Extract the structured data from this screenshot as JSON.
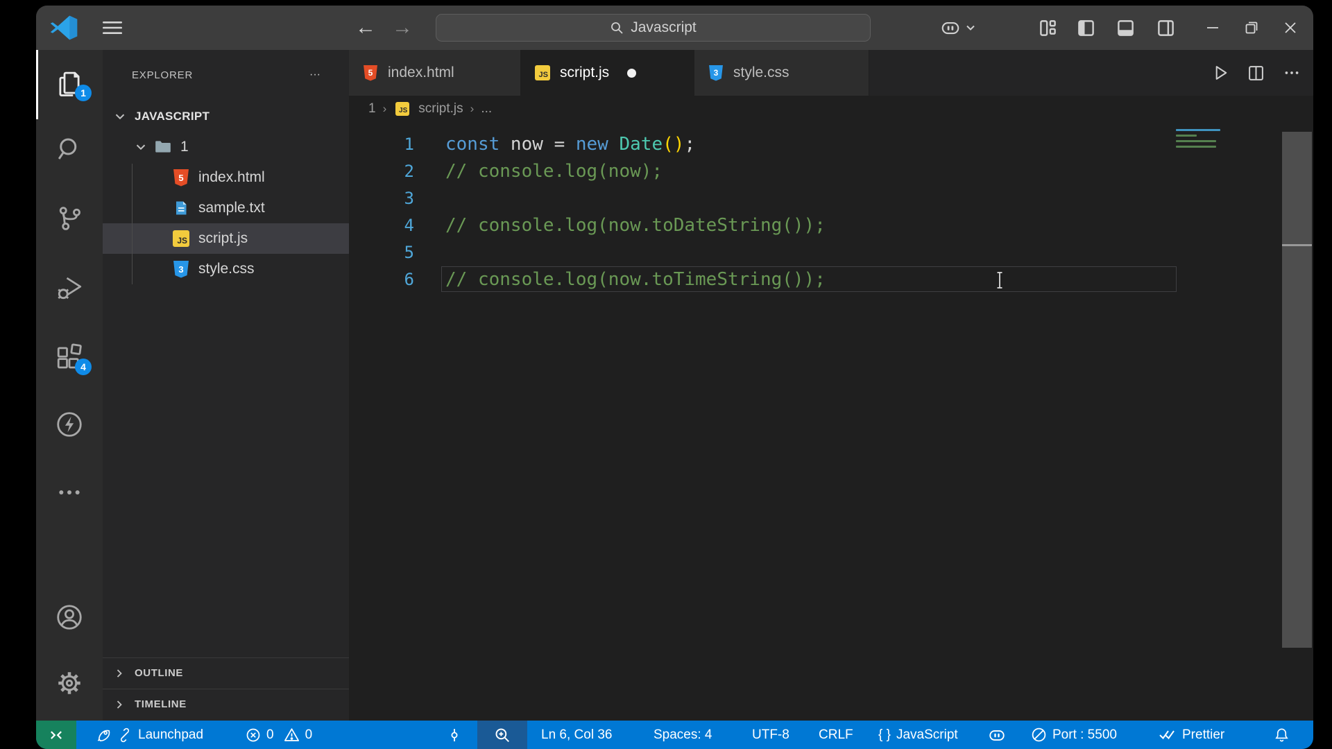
{
  "titlebar": {
    "command_center_text": "Javascript"
  },
  "activity_bar": {
    "explorer_badge": "1",
    "extensions_badge": "4"
  },
  "sidebar": {
    "header": "EXPLORER",
    "more": "···",
    "workspace": "JAVASCRIPT",
    "folder": "1",
    "files": [
      {
        "name": "index.html",
        "type": "html"
      },
      {
        "name": "sample.txt",
        "type": "txt"
      },
      {
        "name": "script.js",
        "type": "js"
      },
      {
        "name": "style.css",
        "type": "css"
      }
    ],
    "selected_file": "script.js",
    "sections": {
      "outline": "OUTLINE",
      "timeline": "TIMELINE"
    }
  },
  "tabs": [
    {
      "label": "index.html",
      "type": "html",
      "active": false,
      "modified": false
    },
    {
      "label": "script.js",
      "type": "js",
      "active": true,
      "modified": true
    },
    {
      "label": "style.css",
      "type": "css",
      "active": false,
      "modified": false
    }
  ],
  "breadcrumb": {
    "folder": "1",
    "file": "script.js",
    "ellipsis": "..."
  },
  "editor": {
    "language": "javascript",
    "lines": [
      {
        "num": "1",
        "current": false,
        "tokens": [
          {
            "t": "const",
            "c": "keyword"
          },
          {
            "t": " now ",
            "c": "text"
          },
          {
            "t": "=",
            "c": "text"
          },
          {
            "t": " ",
            "c": "text"
          },
          {
            "t": "new",
            "c": "keyword"
          },
          {
            "t": " ",
            "c": "text"
          },
          {
            "t": "Date",
            "c": "class"
          },
          {
            "t": "()",
            "c": "bracket"
          },
          {
            "t": ";",
            "c": "text"
          }
        ]
      },
      {
        "num": "2",
        "current": false,
        "tokens": [
          {
            "t": "// console.log(now);",
            "c": "comment"
          }
        ]
      },
      {
        "num": "3",
        "current": false,
        "tokens": []
      },
      {
        "num": "4",
        "current": false,
        "tokens": [
          {
            "t": "// console.log(now.toDateString());",
            "c": "comment"
          }
        ]
      },
      {
        "num": "5",
        "current": false,
        "tokens": []
      },
      {
        "num": "6",
        "current": true,
        "tokens": [
          {
            "t": "// console.log(now.toTimeString());",
            "c": "comment"
          }
        ]
      }
    ]
  },
  "status_bar": {
    "launchpad": "Launchpad",
    "errors": "0",
    "warnings": "0",
    "cursor_position": "Ln 6, Col 36",
    "indentation": "Spaces: 4",
    "encoding": "UTF-8",
    "eol": "CRLF",
    "language_symbol": "{ }",
    "language": "JavaScript",
    "port": "Port : 5500",
    "formatter": "Prettier"
  },
  "colors": {
    "keyword": "#569cd6",
    "class": "#4ec9b0",
    "bracket": "#ffd602",
    "comment": "#6a9955",
    "text": "#d4d4d4",
    "line_number": "#4fa7d9",
    "status_bar": "#0078d4",
    "remote_green": "#16825d",
    "badge_blue": "#0f8be8",
    "html_icon": "#e44d26",
    "css_icon": "#2796e8",
    "js_icon": "#f2cb3d",
    "txt_icon": "#3f9bd8",
    "folder_icon": "#93a7b0"
  }
}
